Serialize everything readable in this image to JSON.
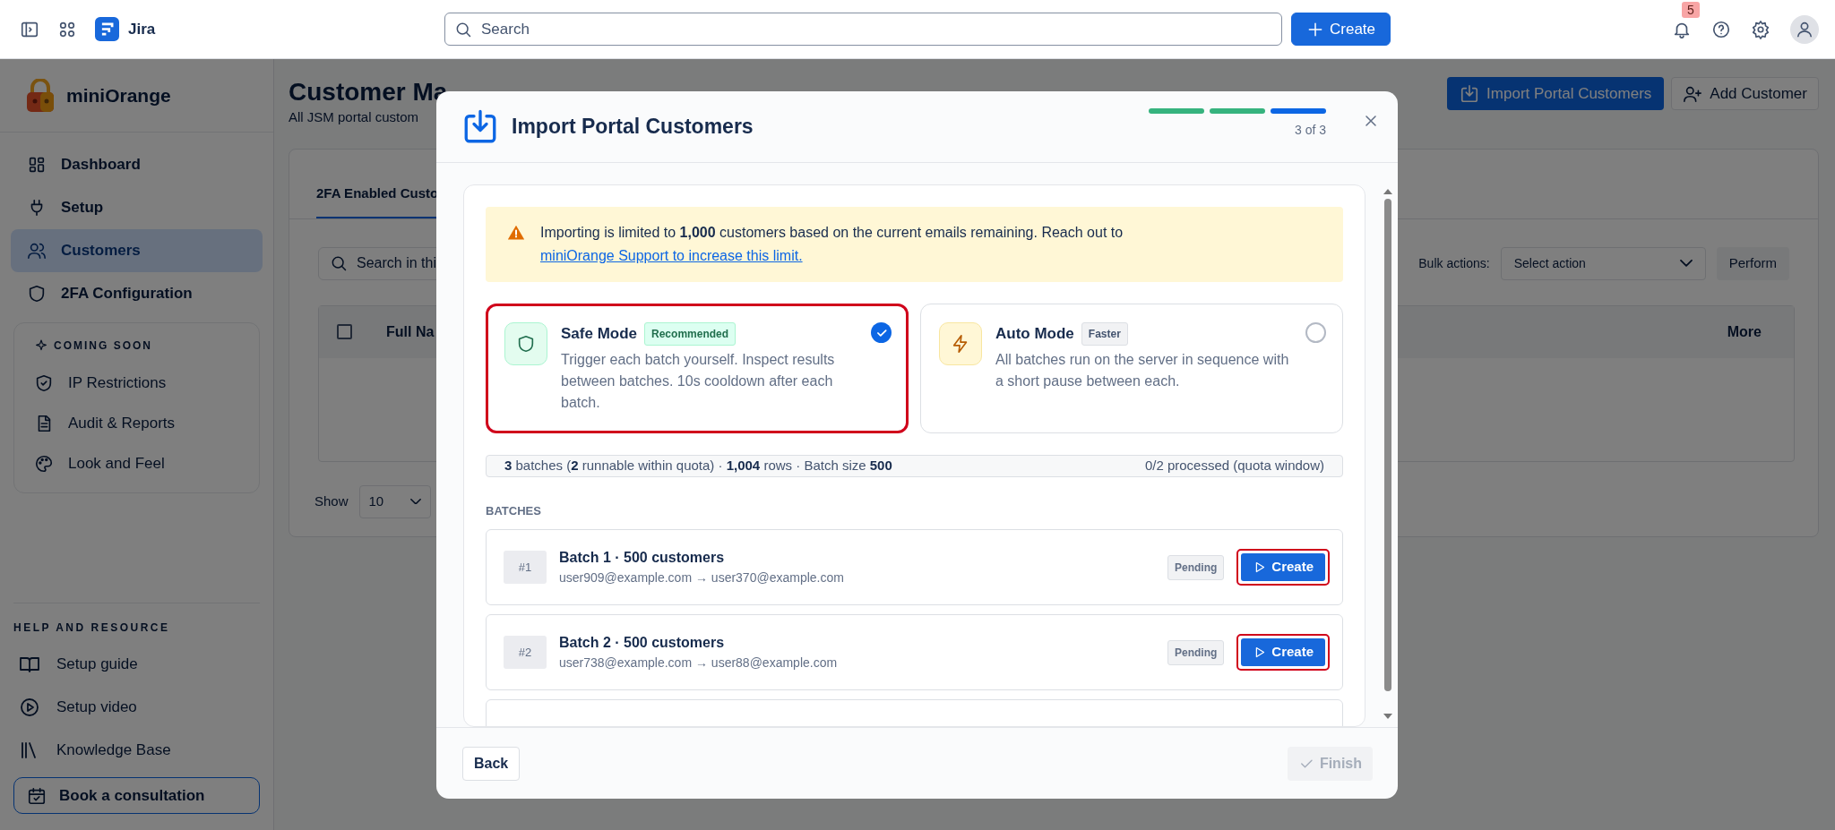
{
  "top_bar": {
    "app_name": "Jira",
    "search": {
      "placeholder": "Search"
    },
    "create_button": "Create",
    "notification_count": "5"
  },
  "sidebar": {
    "brand": "miniOrange",
    "items": [
      {
        "label": "Dashboard",
        "selected": false
      },
      {
        "label": "Setup",
        "selected": false
      },
      {
        "label": "Customers",
        "selected": true
      },
      {
        "label": "2FA Configuration",
        "selected": false
      }
    ],
    "coming_soon": {
      "label": "COMING SOON",
      "items": [
        "IP Restrictions",
        "Audit & Reports",
        "Look and Feel"
      ]
    },
    "help": {
      "heading": "HELP AND RESOURCE",
      "items": [
        "Setup guide",
        "Setup video",
        "Knowledge Base"
      ]
    },
    "consultation_button": "Book a consultation"
  },
  "page": {
    "title": "Customer Ma",
    "subtitle": "All JSM portal custom",
    "buttons": [
      "Import Portal Customers",
      "Add Customer"
    ],
    "tabs": [
      {
        "label": "2FA Enabled Custo",
        "selected": true
      }
    ],
    "search": {
      "placeholder": "Search in thi"
    },
    "bulk_label": "Bulk actions:",
    "bulk_select": "Select action",
    "perform_button": "Perform",
    "select_all": {
      "checked": false
    },
    "columns": [
      "Full Na",
      "More"
    ],
    "show_label": "Show",
    "page_size": "10"
  },
  "modal": {
    "title": "Import Portal Customers",
    "steps": [
      {
        "completed": true
      },
      {
        "completed": true
      },
      {
        "completed": false
      }
    ],
    "step_label": "3 of 3",
    "alert": {
      "text": "Importing is limited to **1,000** customers based on the current emails remaining. Reach out to",
      "link": "miniOrange Support to increase this limit."
    },
    "modes": [
      {
        "kind": "shield",
        "title": "Safe Mode",
        "tag": "Recommended",
        "description": "Trigger each batch yourself. Inspect results between batches. 10s cooldown after each batch.",
        "selected": true
      },
      {
        "kind": "bolt",
        "title": "Auto Mode",
        "tag": "Faster",
        "description": "All batches run on the server in sequence with a short pause between each.",
        "selected": false
      }
    ],
    "summary": {
      "text": "**3** batches (**2** runnable within quota) · **1,004** rows · Batch size **500**",
      "status": "0/2 processed (quota window)"
    },
    "batches_label": "BATCHES",
    "batches": [
      {
        "index": "#1",
        "title": "Batch 1 · 500 customers",
        "range": "user909@example.com → user370@example.com",
        "status": "Pending",
        "action": "Create",
        "highlighted": true
      },
      {
        "index": "#2",
        "title": "Batch 2 · 500 customers",
        "range": "user738@example.com → user88@example.com",
        "status": "Pending",
        "action": "Create",
        "highlighted": true
      }
    ],
    "footer": {
      "back": "Back",
      "finish": {
        "label": "Finish",
        "disabled": true
      }
    }
  }
}
